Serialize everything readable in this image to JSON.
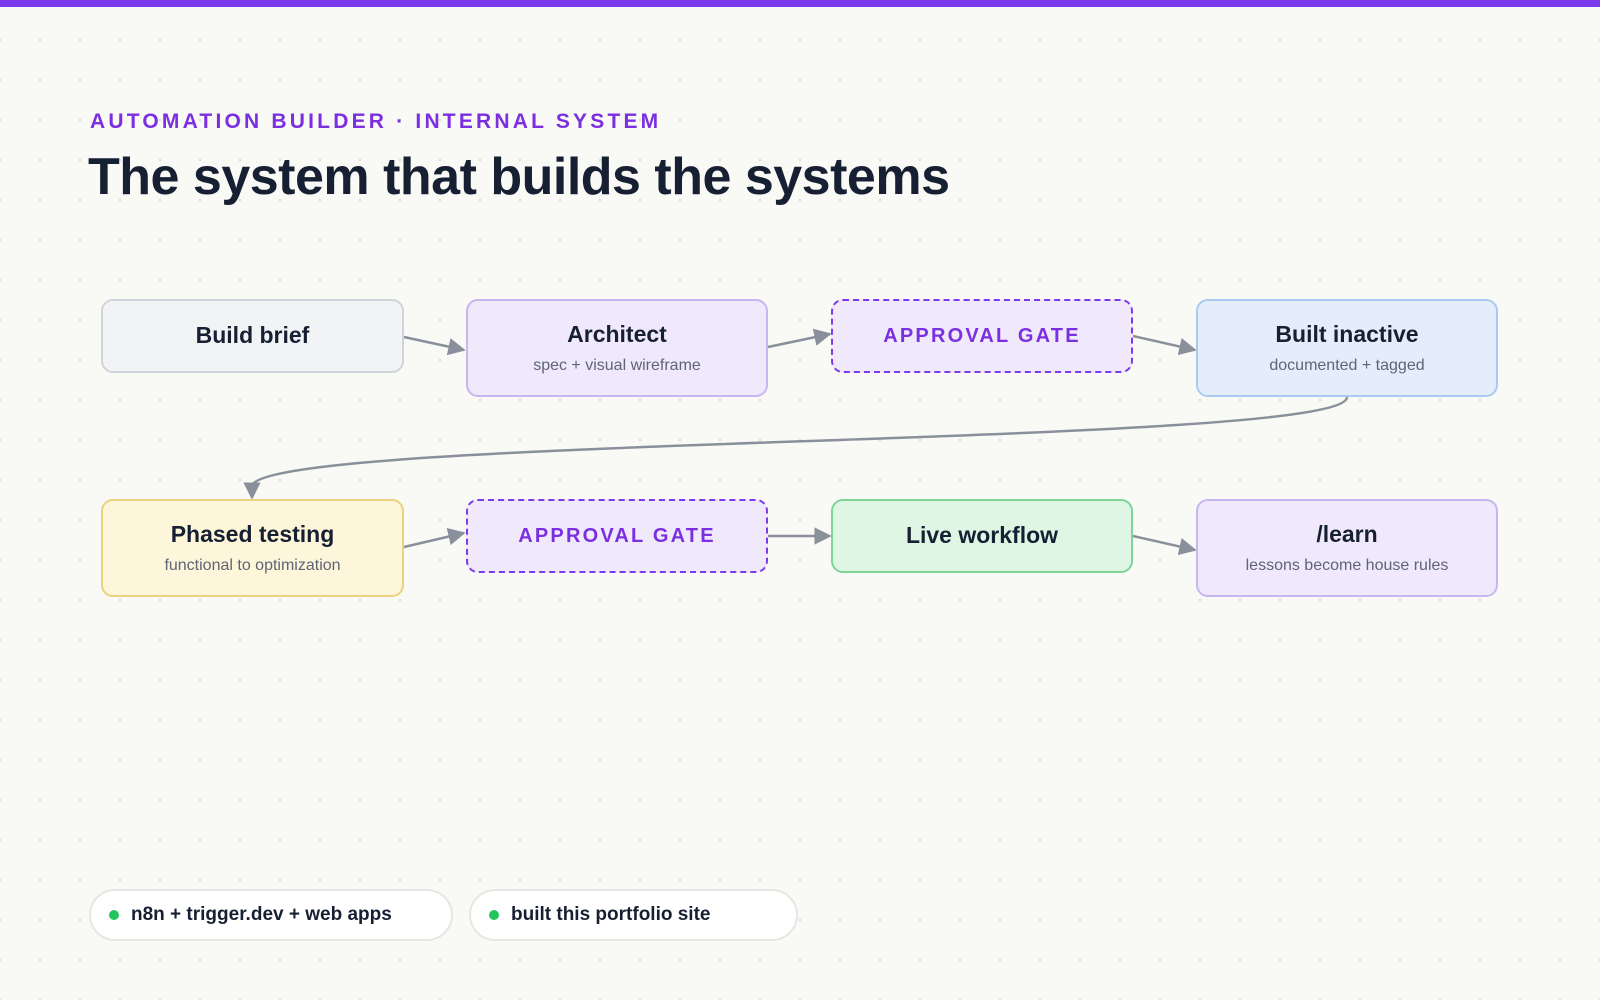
{
  "header": {
    "eyebrow": "AUTOMATION BUILDER · INTERNAL SYSTEM",
    "title": "The system that builds the systems"
  },
  "nodes": {
    "build_brief": {
      "label": "Build brief"
    },
    "architect": {
      "label": "Architect",
      "sub": "spec + visual wireframe"
    },
    "gate1": {
      "label": "APPROVAL GATE"
    },
    "built_inactive": {
      "label": "Built inactive",
      "sub": "documented + tagged"
    },
    "phased_testing": {
      "label": "Phased testing",
      "sub": "functional to optimization"
    },
    "gate2": {
      "label": "APPROVAL GATE"
    },
    "live_workflow": {
      "label": "Live workflow"
    },
    "learn": {
      "label": "/learn",
      "sub": "lessons become house rules"
    }
  },
  "edges": [
    [
      "build_brief",
      "architect"
    ],
    [
      "architect",
      "gate1"
    ],
    [
      "gate1",
      "built_inactive"
    ],
    [
      "built_inactive",
      "phased_testing"
    ],
    [
      "phased_testing",
      "gate2"
    ],
    [
      "gate2",
      "live_workflow"
    ],
    [
      "live_workflow",
      "learn"
    ]
  ],
  "footer": {
    "pills": [
      {
        "label": "n8n + trigger.dev + web apps"
      },
      {
        "label": "built this portfolio site"
      }
    ]
  },
  "colors": {
    "accent": "#7c3aed",
    "status_dot": "#22c55e",
    "edge": "#8a909b"
  }
}
